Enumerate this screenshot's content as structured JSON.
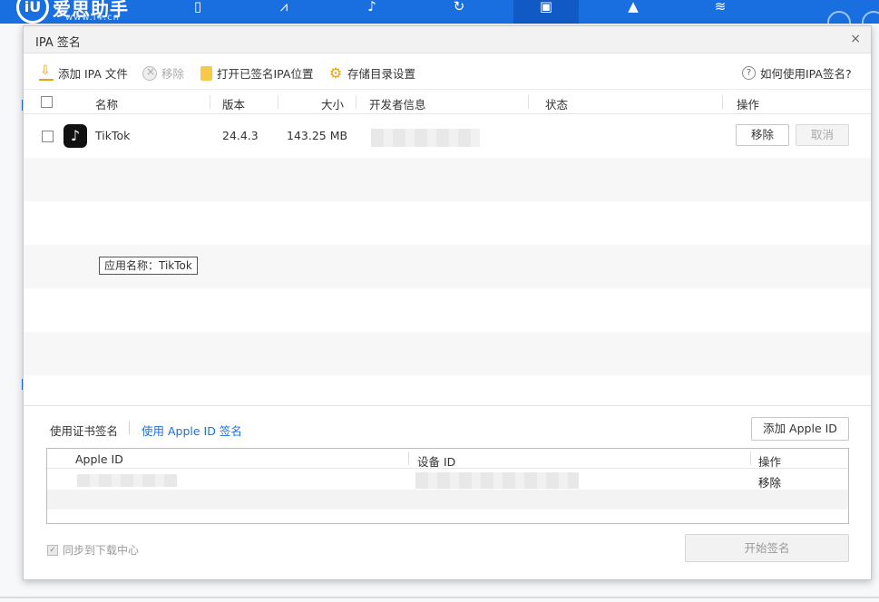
{
  "app": {
    "logo_mark": "iU",
    "logo_name": "爱思助手",
    "logo_url": "www.i4.cn"
  },
  "dialog": {
    "title": "IPA 签名",
    "close_glyph": "×"
  },
  "toolbar": {
    "add_ipa": "添加 IPA 文件",
    "remove": "移除",
    "open_signed": "打开已签名IPA位置",
    "storage_settings": "存储目录设置",
    "help": "如何使用IPA签名?",
    "help_glyph": "?"
  },
  "table": {
    "headers": {
      "name": "名称",
      "version": "版本",
      "size": "大小",
      "developer": "开发者信息",
      "status": "状态",
      "action": "操作"
    },
    "rows": [
      {
        "name": "TikTok",
        "version": "24.4.3",
        "size": "143.25 MB",
        "developer": "",
        "status": "",
        "remove_label": "移除",
        "cancel_label": "取消"
      }
    ],
    "tooltip": "应用名称：TikTok"
  },
  "sign": {
    "tab_cert": "使用证书签名",
    "tab_apple_id": "使用 Apple ID 签名",
    "add_apple_id": "添加 Apple ID",
    "headers": {
      "apple_id": "Apple ID",
      "device_id": "设备 ID",
      "action": "操作"
    },
    "rows": [
      {
        "apple_id": "",
        "device_id": "",
        "action": "移除"
      }
    ],
    "sync_label": "同步到下载中心",
    "sync_checked": true,
    "start_button": "开始签名"
  },
  "colors": {
    "brand": "#1a6fe0",
    "link": "#1a6fe0",
    "accent_icon": "#e8a317"
  }
}
